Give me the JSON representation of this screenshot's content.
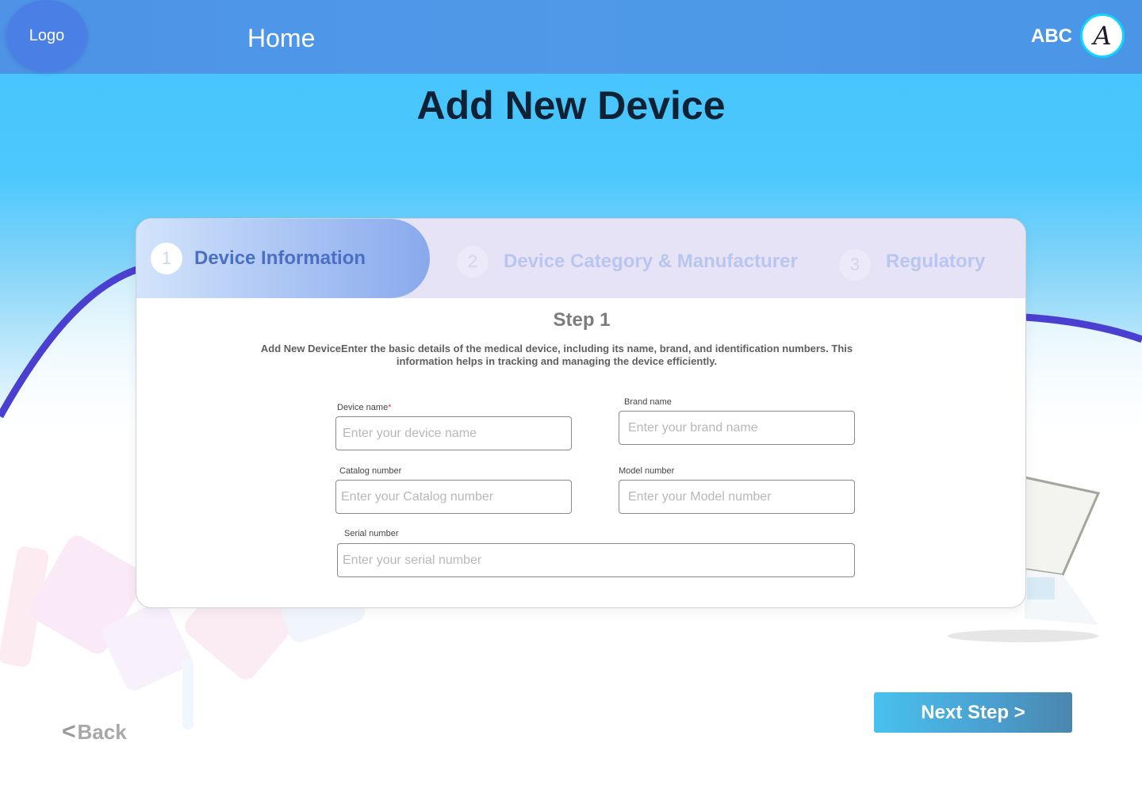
{
  "header": {
    "logo_text": "Logo",
    "nav_home": "Home",
    "user_initials": "ABC",
    "avatar_glyph": "A"
  },
  "page": {
    "title": "Add New Device"
  },
  "stepper": {
    "steps": [
      {
        "number": "1",
        "label": "Device Information",
        "active": true
      },
      {
        "number": "2",
        "label": "Device Category & Manufacturer",
        "active": false
      },
      {
        "number": "3",
        "label": "Regulatory",
        "active": false
      }
    ]
  },
  "form": {
    "step_heading": "Step 1",
    "description": "Add New DeviceEnter the basic details of the medical device, including its name, brand, and identification numbers. This information helps in tracking and managing the device efficiently.",
    "fields": {
      "device_name": {
        "label": "Device name",
        "required_mark": "*",
        "placeholder": "Enter your device name",
        "value": ""
      },
      "brand_name": {
        "label": "Brand name",
        "placeholder": "Enter your brand name",
        "value": ""
      },
      "catalog_number": {
        "label": "Catalog number",
        "placeholder": "Enter your Catalog number",
        "value": ""
      },
      "model_number": {
        "label": "Model number",
        "placeholder": "Enter your Model number",
        "value": ""
      },
      "serial_number": {
        "label": "Serial number",
        "placeholder": "Enter your serial number",
        "value": ""
      }
    }
  },
  "footer": {
    "back_label": "Back",
    "next_label": "Next Step >"
  },
  "colors": {
    "header_blue": "#4e93e6",
    "sky_blue": "#44c3fc",
    "curve_purple": "#4a3fd0",
    "title_dark": "#0f2235",
    "active_step_text": "#4a6fc3",
    "required_red": "#e23b3b",
    "next_button": "#48c1ee"
  },
  "icons": {
    "back": "chevron-left-icon",
    "avatar": "user-avatar-icon"
  }
}
